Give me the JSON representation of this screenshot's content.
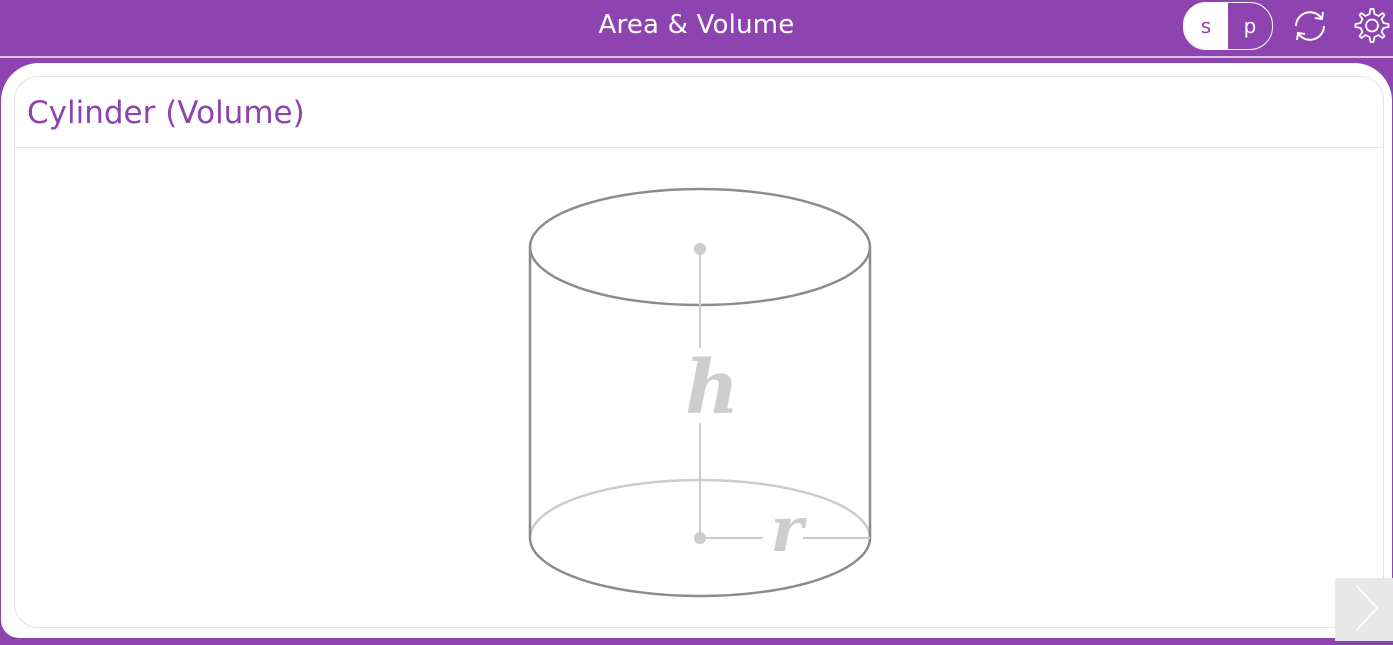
{
  "header": {
    "title": "Area & Volume",
    "toggle_s": "s",
    "toggle_p": "p",
    "refresh_icon": "refresh-icon",
    "settings_icon": "gear-icon"
  },
  "card": {
    "title": "Cylinder (Volume)"
  },
  "diagram": {
    "height_label": "h",
    "radius_label": "r"
  },
  "navigation": {
    "next_icon": "chevron-right-icon"
  },
  "colors": {
    "brand": "#8e44b0",
    "outline": "#8c8c8c",
    "hidden_edge": "#cccccc",
    "label": "#cdcdcd"
  }
}
